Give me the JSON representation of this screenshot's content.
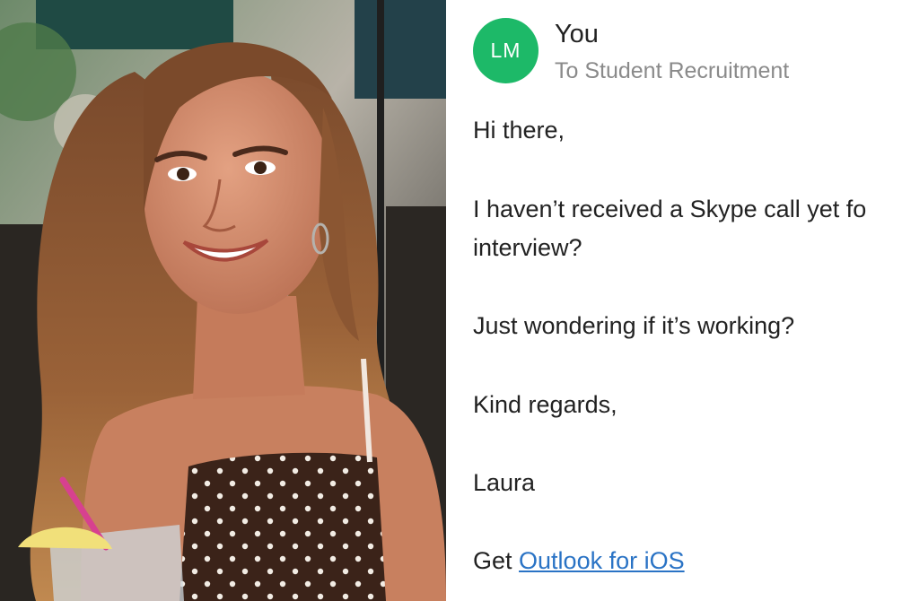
{
  "email": {
    "avatar_initials": "LM",
    "sender": "You",
    "recipient": "To Student Recruitment",
    "greeting": "Hi there,",
    "paragraph_1_line_1": "I haven’t received a Skype call yet fo",
    "paragraph_1_line_2": "interview?",
    "paragraph_2": "Just wondering if it’s working?",
    "closing": "Kind regards,",
    "signature": "Laura",
    "footer_prefix": "Get ",
    "footer_link": "Outlook for iOS"
  },
  "colors": {
    "avatar_bg": "#1db968",
    "link": "#2a73c5",
    "secondary_text": "#8a8a8a",
    "body_text": "#222222"
  }
}
